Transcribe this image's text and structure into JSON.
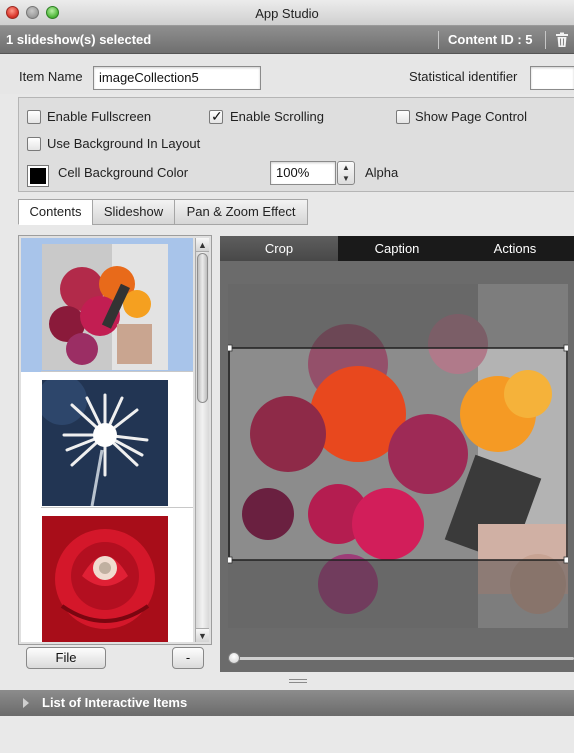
{
  "window": {
    "title": "App Studio"
  },
  "selection_bar": {
    "text": "1 slideshow(s) selected",
    "content_id": "Content ID : 5"
  },
  "item": {
    "name_label": "Item Name",
    "name_value": "imageCollection5",
    "stat_label": "Statistical identifier",
    "stat_value": ""
  },
  "options": {
    "enable_fullscreen": {
      "label": "Enable Fullscreen",
      "checked": false
    },
    "enable_scrolling": {
      "label": "Enable Scrolling",
      "checked": true
    },
    "show_page_control": {
      "label": "Show Page Control",
      "checked": false
    },
    "use_background": {
      "label": "Use Background In Layout",
      "checked": false
    },
    "cell_bg_label": "Cell Background Color",
    "cell_bg_color": "#000000",
    "alpha_value": "100%",
    "alpha_label": "Alpha"
  },
  "tabs": {
    "contents": "Contents",
    "slideshow": "Slideshow",
    "panzoom": "Pan & Zoom Effect",
    "active": "Contents"
  },
  "thumbnails": [
    {
      "icon": "flower-bouquet-image",
      "selected": true
    },
    {
      "icon": "white-chrysanthemum-image",
      "selected": false
    },
    {
      "icon": "red-rose-image",
      "selected": false
    }
  ],
  "buttons": {
    "file": "File",
    "remove": "-"
  },
  "editor_tabs": {
    "crop": "Crop",
    "caption": "Caption",
    "actions": "Actions",
    "active": "Crop"
  },
  "bottom": {
    "list_label": "List of Interactive Items"
  },
  "colors": {
    "selection_blue": "#a8c4ea",
    "editor_bg": "#6b6b6b",
    "tab_bar": "#1a1a1a"
  },
  "icons": {
    "trash": "trash-icon",
    "up": "scroll-up-arrow-icon",
    "down": "scroll-down-arrow-icon"
  }
}
